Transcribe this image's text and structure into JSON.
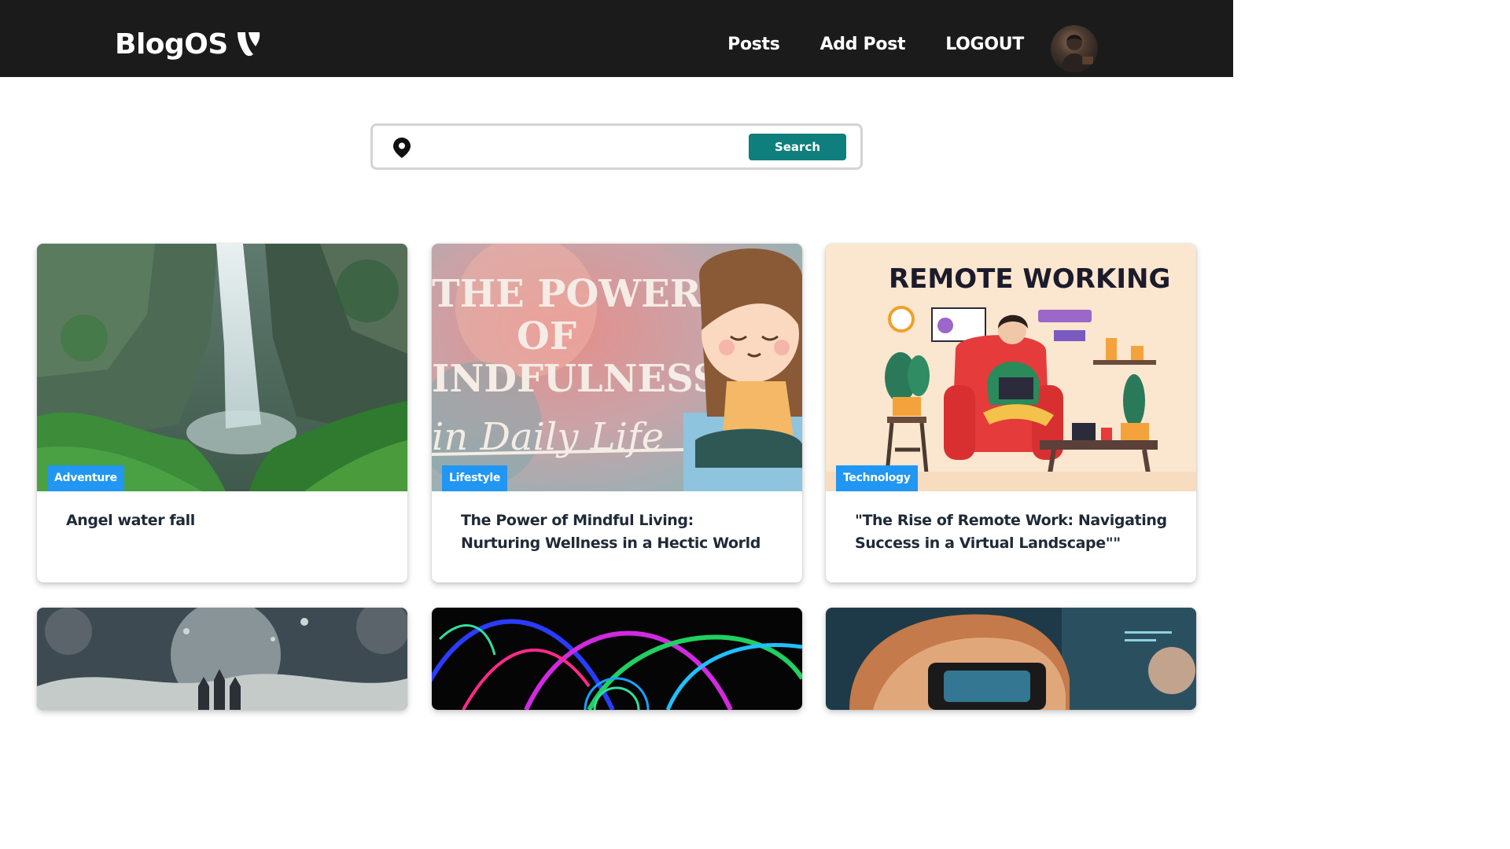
{
  "nav": {
    "brand": "BlogOS",
    "links": [
      "Posts",
      "Add Post",
      "LOGOUT"
    ]
  },
  "search": {
    "value": "",
    "placeholder": "",
    "button_label": "Search"
  },
  "posts": [
    {
      "category": "Adventure",
      "title": "Angel water fall",
      "image_icon": "waterfall-image"
    },
    {
      "category": "Lifestyle",
      "title": "The Power of Mindful Living: Nurturing Wellness in a Hectic World",
      "image_icon": "mindfulness-image",
      "image_text": {
        "line1": "THE POWER",
        "line2": "OF",
        "line3": "INDFULNESS",
        "line4": "in Daily Life"
      }
    },
    {
      "category": "Technology",
      "title": "\"The Rise of Remote Work: Navigating Success in a Virtual Landscape\"\"",
      "image_icon": "remote-working-image",
      "image_text": {
        "heading": "REMOTE WORKING"
      }
    },
    {
      "category": "",
      "title": "",
      "image_icon": "fantasy-castle-image"
    },
    {
      "category": "",
      "title": "",
      "image_icon": "neon-lines-image"
    },
    {
      "category": "",
      "title": "",
      "image_icon": "vr-headset-image"
    }
  ],
  "colors": {
    "navbar_bg": "#1b1b1b",
    "search_button": "#0e7f7c",
    "badge": "#2196f3",
    "title_text": "#1f2a37"
  }
}
